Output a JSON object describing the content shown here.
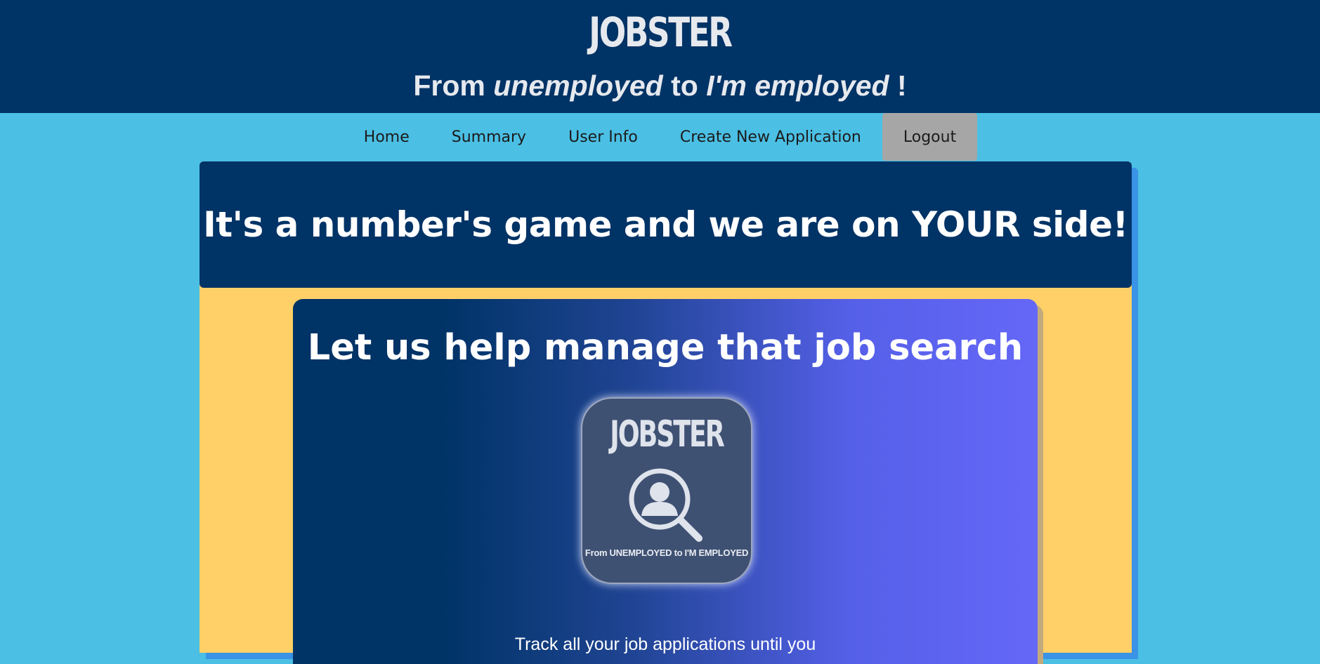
{
  "header": {
    "brand": "JOBSTER",
    "tagline": {
      "part1": "From ",
      "part2": "unemployed",
      "part3": " to ",
      "part4": "I'm employed",
      "part5": " !"
    }
  },
  "nav": {
    "items": [
      {
        "label": "Home"
      },
      {
        "label": "Summary"
      },
      {
        "label": "User Info"
      },
      {
        "label": "Create New Application"
      },
      {
        "label": "Logout"
      }
    ]
  },
  "hero": {
    "title": "It's a number's game and we are on YOUR side!"
  },
  "feature": {
    "title": "Let us help manage that job search",
    "logo_brand": "JOBSTER",
    "logo_caption": "From UNEMPLOYED to I'M EMPLOYED",
    "logo_icon": "search-person-icon",
    "text": "Track all your job applications until you"
  },
  "colors": {
    "header_bg": "#003366",
    "page_bg": "#4bbfe4",
    "card_bg": "#ffd068",
    "logout_bg": "#a6a6a6",
    "gradient_end": "#6567f7"
  }
}
